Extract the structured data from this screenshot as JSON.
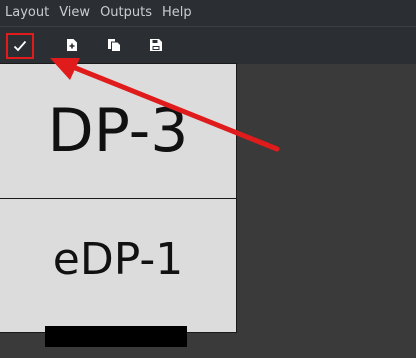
{
  "menubar": {
    "items": [
      {
        "label": "Layout"
      },
      {
        "label": "View"
      },
      {
        "label": "Outputs"
      },
      {
        "label": "Help"
      }
    ]
  },
  "toolbar": {
    "buttons": [
      {
        "icon": "checkmark-icon"
      },
      {
        "icon": "new-file-icon"
      },
      {
        "icon": "copy-file-icon"
      },
      {
        "icon": "save-file-icon"
      }
    ]
  },
  "monitors": [
    {
      "label": "DP-3"
    },
    {
      "label": "eDP-1"
    }
  ],
  "annotation": {
    "color": "#e01b1b"
  }
}
